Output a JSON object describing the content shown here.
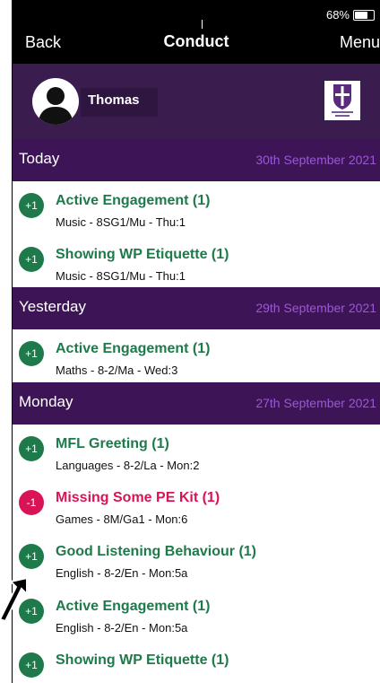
{
  "status": {
    "battery": "68%",
    "battery_level": 0.68
  },
  "nav": {
    "back": "Back",
    "title": "Conduct",
    "menu": "Menu"
  },
  "profile": {
    "name": "Thomas"
  },
  "sections": [
    {
      "day": "Today",
      "date": "30th September 2021",
      "items": [
        {
          "badge": "+1",
          "title": "Active Engagement (1)",
          "sub": "Music - 8SG1/Mu - Thu:1"
        },
        {
          "badge": "+1",
          "title": "Showing WP Etiquette (1)",
          "sub": "Music - 8SG1/Mu - Thu:1"
        }
      ]
    },
    {
      "day": "Yesterday",
      "date": "29th September 2021",
      "items": [
        {
          "badge": "+1",
          "title": "Active Engagement (1)",
          "sub": "Maths - 8-2/Ma - Wed:3"
        }
      ]
    },
    {
      "day": "Monday",
      "date": "27th September 2021",
      "items": [
        {
          "badge": "+1",
          "title": "MFL Greeting (1)",
          "sub": "Languages - 8-2/La - Mon:2"
        },
        {
          "badge": "-1",
          "title": "Missing Some PE Kit (1)",
          "sub": "Games - 8M/Ga1 - Mon:6"
        },
        {
          "badge": "+1",
          "title": "Good Listening Behaviour (1)",
          "sub": "English - 8-2/En - Mon:5a"
        },
        {
          "badge": "+1",
          "title": "Active Engagement (1)",
          "sub": "English - 8-2/En - Mon:5a"
        },
        {
          "badge": "+1",
          "title": "Showing WP Etiquette (1)",
          "sub": ""
        }
      ]
    }
  ],
  "colors": {
    "positive": "#1e7a4a",
    "negative": "#d91456",
    "section_bg": "#3d1556",
    "profile_bg": "#3a1d4e"
  }
}
